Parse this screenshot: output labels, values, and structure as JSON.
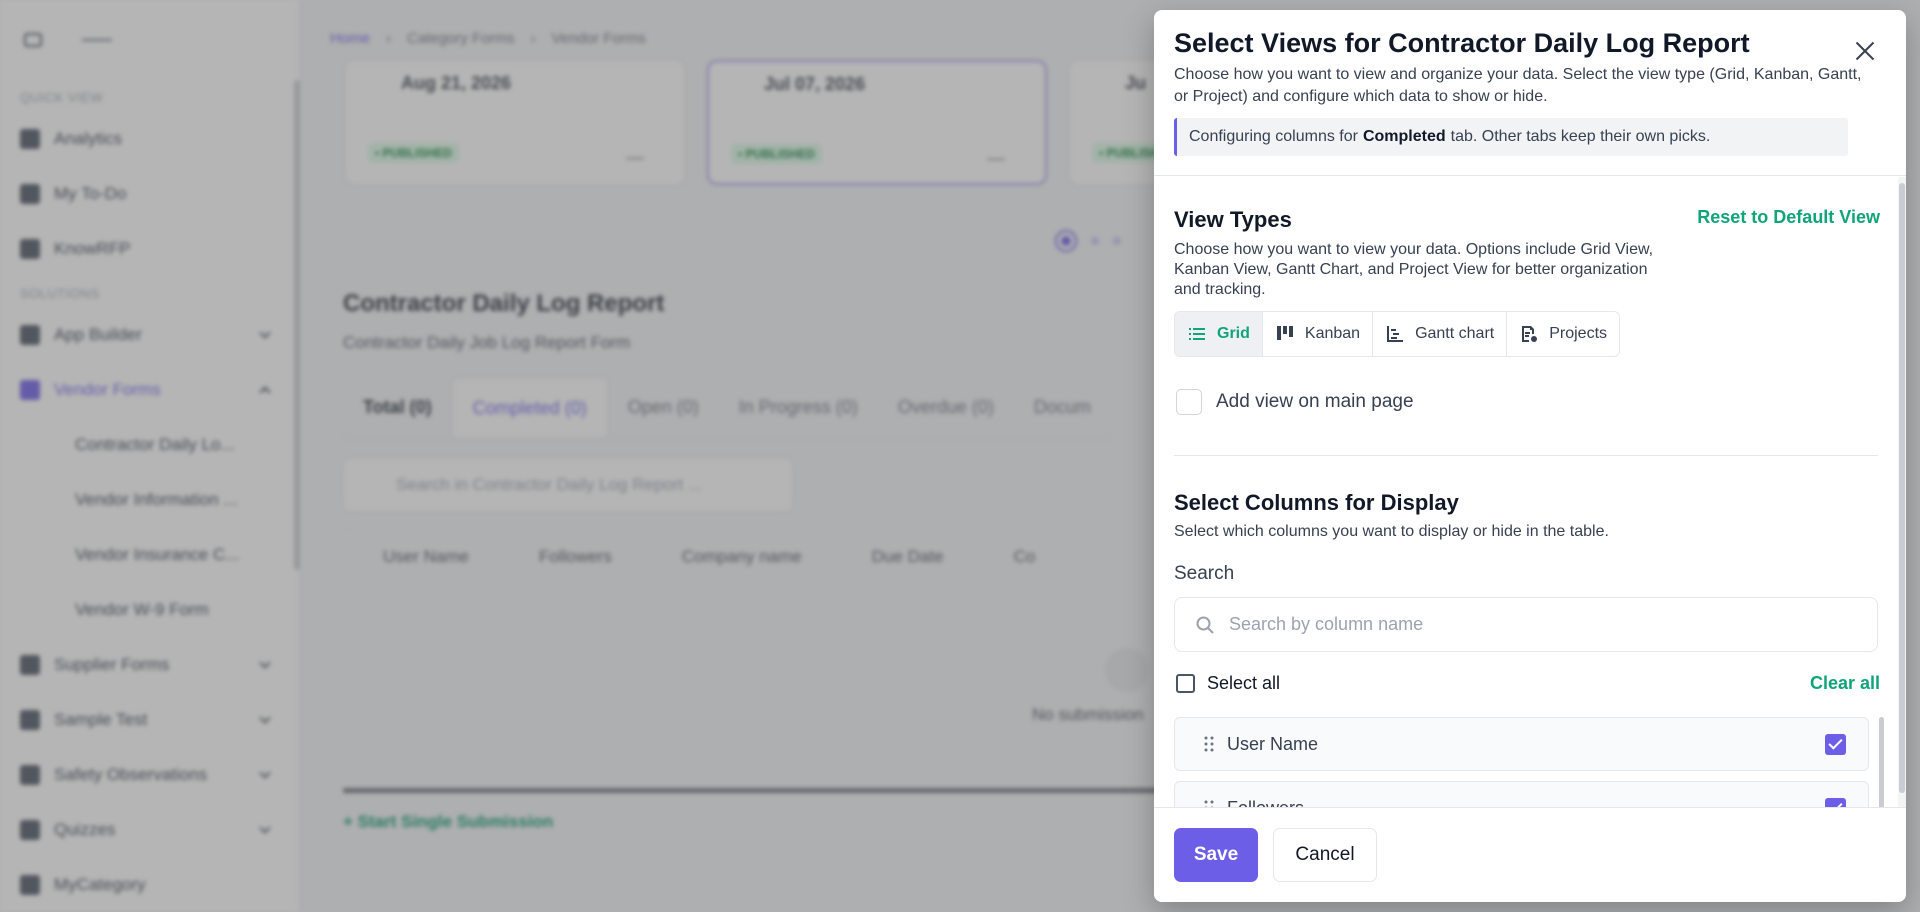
{
  "background": {
    "breadcrumb": [
      "Home",
      "Category Forms",
      "Vendor Forms"
    ],
    "sidebar": {
      "sections": [
        "QUICK VIEW",
        "SOLUTIONS"
      ],
      "quick_items": [
        "Analytics",
        "My To-Do",
        "KnowRFP"
      ],
      "solution_items": [
        {
          "label": "App Builder",
          "expanded": false
        },
        {
          "label": "Vendor Forms",
          "expanded": true,
          "active": true
        },
        {
          "label": "Supplier Forms",
          "expanded": false
        },
        {
          "label": "Sample Test",
          "expanded": false
        },
        {
          "label": "Safety Observations",
          "expanded": false
        },
        {
          "label": "Quizzes",
          "expanded": false
        },
        {
          "label": "MyCategory",
          "expanded": false
        }
      ],
      "vendor_sub_items": [
        "Contractor Daily Lo...",
        "Vendor Information ...",
        "Vendor Insurance C...",
        "Vendor W-9 Form"
      ]
    },
    "cards": [
      {
        "date": "Aug 21, 2026",
        "status": "• PUBLISHED"
      },
      {
        "date": "Jul 07, 2026",
        "status": "• PUBLISHED"
      },
      {
        "date": "Ju",
        "status": "• PUBLISHED"
      }
    ],
    "form_title": "Contractor Daily Log Report",
    "form_subtitle": "Contractor Daily Job Log Report Form",
    "tabs": [
      "Total (0)",
      "Completed (0)",
      "Open (0)",
      "In Progress (0)",
      "Overdue (0)",
      "Docum"
    ],
    "search_placeholder": "Search in Contractor Daily Log Report ...",
    "columns": [
      "User Name",
      "Followers",
      "Company name",
      "Due Date",
      "Co"
    ],
    "empty_text": "No submission",
    "start_link": "+ Start Single Submission"
  },
  "modal": {
    "title": "Select Views for Contractor Daily Log Report",
    "description": "Choose how you want to view and organize your data. Select the view type (Grid, Kanban, Gantt, or Project) and configure which data to show or hide.",
    "info_prefix": "Configuring columns for",
    "info_tab": "Completed",
    "info_suffix": "tab. Other tabs keep their own picks.",
    "view_types_title": "View Types",
    "reset_label": "Reset to Default View",
    "view_types_desc": "Choose how you want to view your data. Options include Grid View, Kanban View, Gantt Chart, and Project View for better organization and tracking.",
    "view_options": [
      {
        "label": "Grid",
        "icon": "list-icon",
        "active": true
      },
      {
        "label": "Kanban",
        "icon": "kanban-icon",
        "active": false
      },
      {
        "label": "Gantt chart",
        "icon": "gantt-icon",
        "active": false
      },
      {
        "label": "Projects",
        "icon": "projects-icon",
        "active": false
      }
    ],
    "add_view_label": "Add view on main page",
    "columns_title": "Select Columns for Display",
    "columns_desc": "Select which columns you want to display or hide in the table.",
    "search_label": "Search",
    "search_placeholder": "Search by column name",
    "select_all_label": "Select all",
    "clear_all_label": "Clear all",
    "column_items": [
      {
        "label": "User Name",
        "checked": true
      },
      {
        "label": "Followers",
        "checked": true
      }
    ],
    "save_label": "Save",
    "cancel_label": "Cancel"
  },
  "colors": {
    "accent": "#6d5ee8",
    "green": "#10a47a"
  }
}
